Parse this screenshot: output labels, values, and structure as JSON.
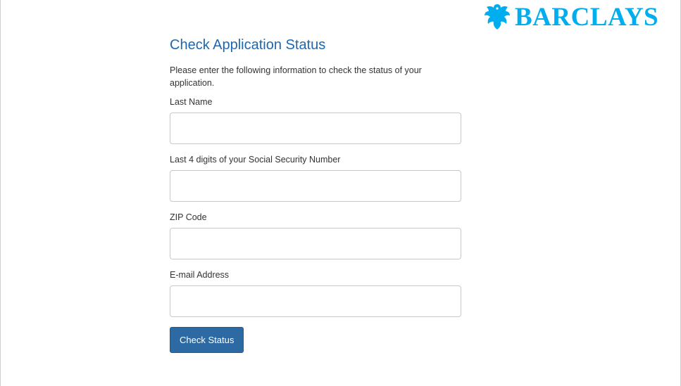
{
  "brand": {
    "name": "BARCLAYS",
    "logo_icon": "eagle-icon",
    "color": "#00aeef"
  },
  "form": {
    "title": "Check Application Status",
    "intro": "Please enter the following information to check the status of your application.",
    "fields": [
      {
        "label": "Last Name",
        "value": "",
        "placeholder": ""
      },
      {
        "label": "Last 4 digits of your Social Security Number",
        "value": "",
        "placeholder": ""
      },
      {
        "label": "ZIP Code",
        "value": "",
        "placeholder": ""
      },
      {
        "label": "E-mail Address",
        "value": "",
        "placeholder": ""
      }
    ],
    "submit_label": "Check Status"
  },
  "colors": {
    "title": "#1c67b1",
    "button": "#2d6aa3"
  }
}
